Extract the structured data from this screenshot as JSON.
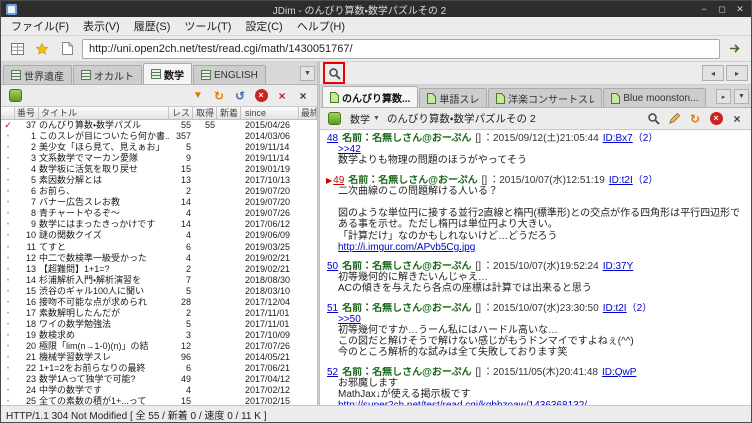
{
  "titlebar": {
    "title": "JDim - のんびり算数・数学パズルその 2",
    "minimize": "−",
    "maximize": "◻",
    "close": "✕"
  },
  "menubar": {
    "items": [
      "ファイル(F)",
      "表示(V)",
      "履歴(S)",
      "ツール(T)",
      "設定(C)",
      "ヘルプ(H)"
    ]
  },
  "urlbar": {
    "url": "http://uni.open2ch.net/test/read.cgi/math/1430051767/"
  },
  "icons": {
    "dropdown": "▼",
    "back": "◂",
    "forward": "▸",
    "scroll_right": "▸",
    "refresh": "↻",
    "undo": "↺",
    "down": "▼",
    "x": "×"
  },
  "colors": {
    "annotation_red": "#ee0000",
    "link_blue": "#0000cc",
    "name_green": "#1a661a",
    "bookmark_red": "#cc0000",
    "refresh_orange": "#e07800"
  },
  "board_pane": {
    "tabs": [
      {
        "label": "世界遺産",
        "active": false
      },
      {
        "label": "オカルト",
        "active": false
      },
      {
        "label": "数学",
        "active": true
      },
      {
        "label": "ENGLISH",
        "active": false
      }
    ],
    "columns": {
      "num": "番号",
      "title": "タイトル",
      "res": "レス",
      "got": "取得",
      "new": "新着",
      "since": "since",
      "last": "最終書込"
    },
    "rows": [
      {
        "mark": "✓",
        "marked": true,
        "num": "37",
        "title": "のんびり算数・数学パズル",
        "res": "55",
        "got": "55",
        "new": "",
        "since": "2015/04/26",
        "last": ""
      },
      {
        "mark": "●",
        "marked": false,
        "num": "1",
        "title": "このスレが目についたら何か書...",
        "res": "357",
        "got": "",
        "new": "",
        "since": "2014/03/06",
        "last": ""
      },
      {
        "mark": "●",
        "marked": false,
        "num": "2",
        "title": "美少女「ほら見て、見えぁお」",
        "res": "5",
        "got": "",
        "new": "",
        "since": "2019/11/14",
        "last": ""
      },
      {
        "mark": "●",
        "marked": false,
        "num": "3",
        "title": "文系数学でマーカン愛隊",
        "res": "9",
        "got": "",
        "new": "",
        "since": "2019/11/14",
        "last": ""
      },
      {
        "mark": "●",
        "marked": false,
        "num": "4",
        "title": "数学板に活気を取り戻せ",
        "res": "15",
        "got": "",
        "new": "",
        "since": "2019/01/19",
        "last": ""
      },
      {
        "mark": "●",
        "marked": false,
        "num": "5",
        "title": "素因数分解とは",
        "res": "13",
        "got": "",
        "new": "",
        "since": "2017/10/13",
        "last": ""
      },
      {
        "mark": "●",
        "marked": false,
        "num": "6",
        "title": "お前ら、",
        "res": "2",
        "got": "",
        "new": "",
        "since": "2019/07/20",
        "last": ""
      },
      {
        "mark": "●",
        "marked": false,
        "num": "7",
        "title": "バナー広告スレお教",
        "res": "14",
        "got": "",
        "new": "",
        "since": "2019/07/20",
        "last": ""
      },
      {
        "mark": "●",
        "marked": false,
        "num": "8",
        "title": "青チャートやるぞ〜",
        "res": "4",
        "got": "",
        "new": "",
        "since": "2019/07/26",
        "last": ""
      },
      {
        "mark": "●",
        "marked": false,
        "num": "9",
        "title": "数学にはまったきっかけです",
        "res": "14",
        "got": "",
        "new": "",
        "since": "2017/06/12",
        "last": ""
      },
      {
        "mark": "●",
        "marked": false,
        "num": "10",
        "title": "謎の関数クイズ",
        "res": "4",
        "got": "",
        "new": "",
        "since": "2019/06/09",
        "last": ""
      },
      {
        "mark": "●",
        "marked": false,
        "num": "11",
        "title": "てすと",
        "res": "6",
        "got": "",
        "new": "",
        "since": "2019/03/25",
        "last": ""
      },
      {
        "mark": "●",
        "marked": false,
        "num": "12",
        "title": "中二で数検準一級受かった",
        "res": "4",
        "got": "",
        "new": "",
        "since": "2019/02/21",
        "last": ""
      },
      {
        "mark": "●",
        "marked": false,
        "num": "13",
        "title": "【超難問】1+1=?",
        "res": "2",
        "got": "",
        "new": "",
        "since": "2019/02/21",
        "last": ""
      },
      {
        "mark": "●",
        "marked": false,
        "num": "14",
        "title": "杉浦解析入門・解析演習を",
        "res": "7",
        "got": "",
        "new": "",
        "since": "2018/08/30",
        "last": ""
      },
      {
        "mark": "●",
        "marked": false,
        "num": "15",
        "title": "渋谷のギャル100人に聞い",
        "res": "5",
        "got": "",
        "new": "",
        "since": "2018/03/10",
        "last": ""
      },
      {
        "mark": "●",
        "marked": false,
        "num": "16",
        "title": "接吻不可能な点が求められ",
        "res": "28",
        "got": "",
        "new": "",
        "since": "2017/12/04",
        "last": ""
      },
      {
        "mark": "●",
        "marked": false,
        "num": "17",
        "title": "素数解明したんだが",
        "res": "2",
        "got": "",
        "new": "",
        "since": "2017/11/01",
        "last": ""
      },
      {
        "mark": "●",
        "marked": false,
        "num": "18",
        "title": "ワイの数学勉強法",
        "res": "5",
        "got": "",
        "new": "",
        "since": "2017/11/01",
        "last": ""
      },
      {
        "mark": "●",
        "marked": false,
        "num": "19",
        "title": "数検求め",
        "res": "3",
        "got": "",
        "new": "",
        "since": "2017/10/09",
        "last": ""
      },
      {
        "mark": "●",
        "marked": false,
        "num": "20",
        "title": "極限「lim(n→1-0)(n)」の結",
        "res": "12",
        "got": "",
        "new": "",
        "since": "2017/07/26",
        "last": ""
      },
      {
        "mark": "●",
        "marked": false,
        "num": "21",
        "title": "機械学習数学スレ",
        "res": "96",
        "got": "",
        "new": "",
        "since": "2014/05/21",
        "last": ""
      },
      {
        "mark": "●",
        "marked": false,
        "num": "22",
        "title": "1+1=2をお前らなりの最終",
        "res": "6",
        "got": "",
        "new": "",
        "since": "2017/06/21",
        "last": ""
      },
      {
        "mark": "●",
        "marked": false,
        "num": "23",
        "title": "数学1Aって独学で可能?",
        "res": "49",
        "got": "",
        "new": "",
        "since": "2017/04/12",
        "last": ""
      },
      {
        "mark": "●",
        "marked": false,
        "num": "24",
        "title": "中学の数学です",
        "res": "4",
        "got": "",
        "new": "",
        "since": "2017/02/12",
        "last": ""
      },
      {
        "mark": "●",
        "marked": false,
        "num": "25",
        "title": "全ての素数の積が1+...って",
        "res": "15",
        "got": "",
        "new": "",
        "since": "2017/02/15",
        "last": ""
      }
    ]
  },
  "thread_pane": {
    "tabs": [
      {
        "label": "のんびり算数...",
        "active": true
      },
      {
        "label": "単語スレ",
        "active": false
      },
      {
        "label": "洋楽コンサートスレ",
        "active": false
      },
      {
        "label": "Blue moonston...",
        "active": false
      }
    ],
    "board_label": "数学",
    "title": "のんびり算数・数学パズルその 2",
    "posts": [
      {
        "num": "48",
        "marked": false,
        "marker": "",
        "name_label": "名前：",
        "name": "名無しさん@おーぷん",
        "mail": "[]",
        "date": "：2015/09/12(土)21:05:44",
        "id": "ID:Bx7",
        "id_count": "（2）",
        "lines": [
          {
            "type": "anchor",
            "text": ">>42"
          },
          {
            "type": "text",
            "text": "数学よりも物理の問題のほうがやってそう"
          }
        ]
      },
      {
        "num": "49",
        "marked": true,
        "marker": "▶",
        "name_label": "名前：",
        "name": "名無しさん@おーぷん",
        "mail": "[]",
        "date": "：2015/10/07(水)12:51:19",
        "id": "ID:t2I",
        "id_count": "（2）",
        "lines": [
          {
            "type": "text",
            "text": "二次曲線のこの問題解ける人いる？"
          },
          {
            "type": "blank",
            "text": ""
          },
          {
            "type": "text",
            "text": "図のような単位円に接する並行2直線と楕円(標準形)との交点が作る四角形は平行四辺形である事を示せ。ただし楕円は単位円より大きい。"
          },
          {
            "type": "text",
            "text": "「計算だけ」なのかもしれないけど…どうだろう"
          },
          {
            "type": "link",
            "text": "http://i.imgur.com/APvb5Cg.jpg"
          }
        ]
      },
      {
        "num": "50",
        "marked": false,
        "marker": "",
        "name_label": "名前：",
        "name": "名無しさん@おーぷん",
        "mail": "[]",
        "date": "：2015/10/07(水)19:52:24",
        "id": "ID:37Y",
        "id_count": "",
        "lines": [
          {
            "type": "text",
            "text": "初等幾何的に解きたいんじゃえ…"
          },
          {
            "type": "text",
            "text": "ACの傾きを与えたら各点の座標は計算では出来ると思う"
          }
        ]
      },
      {
        "num": "51",
        "marked": false,
        "marker": "",
        "name_label": "名前：",
        "name": "名無しさん@おーぷん",
        "mail": "[]",
        "date": "：2015/10/07(水)23:30:50",
        "id": "ID:t2I",
        "id_count": "（2）",
        "lines": [
          {
            "type": "anchor",
            "text": ">>50"
          },
          {
            "type": "text",
            "text": "初等幾何ですか…うーん私にはハードル高いな…"
          },
          {
            "type": "text",
            "text": "この図だと解けそうで解けない感じがもうドンマイですよねぇ(^^)"
          },
          {
            "type": "text",
            "text": "今のところ解析的な試みは全て失敗しております笑"
          }
        ]
      },
      {
        "num": "52",
        "marked": false,
        "marker": "",
        "name_label": "名前：",
        "name": "名無しさん@おーぷん",
        "mail": "[]",
        "date": "：2015/11/05(木)20:41:48",
        "id": "ID:QwP",
        "id_count": "",
        "lines": [
          {
            "type": "text",
            "text": "お邪魔します"
          },
          {
            "type": "text",
            "text": "MathJax↓が使える掲示板です"
          },
          {
            "type": "link",
            "text": "http://super2ch.net/test/read.cgi/kqbbzoaw/1436368132/"
          }
        ]
      }
    ]
  },
  "statusbar": {
    "text": "HTTP/1.1 304 Not Modified [ 全 55 / 新着 0 / 速度 0 / 11 K ]"
  }
}
